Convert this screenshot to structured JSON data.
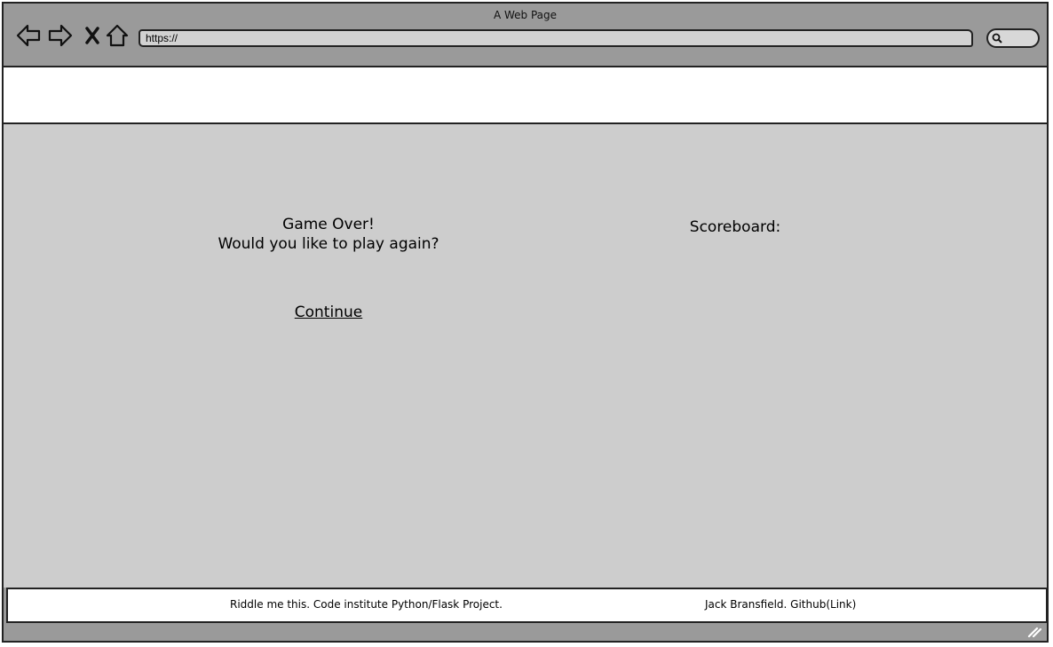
{
  "window": {
    "title": "A Web Page"
  },
  "toolbar": {
    "icons": [
      "back-arrow-icon",
      "forward-arrow-icon",
      "close-x-icon",
      "home-icon"
    ],
    "url": "https://",
    "search_icon": "search-icon"
  },
  "game": {
    "line1": "Game Over!",
    "line2": "Would you like to play again?",
    "continue_label": "Continue"
  },
  "scoreboard": {
    "label": "Scoreboard:"
  },
  "footer": {
    "left_text": "Riddle me this. Code institute Python/Flask Project.",
    "right_text": "Jack Bransfield. Github",
    "right_link": "(Link)"
  }
}
